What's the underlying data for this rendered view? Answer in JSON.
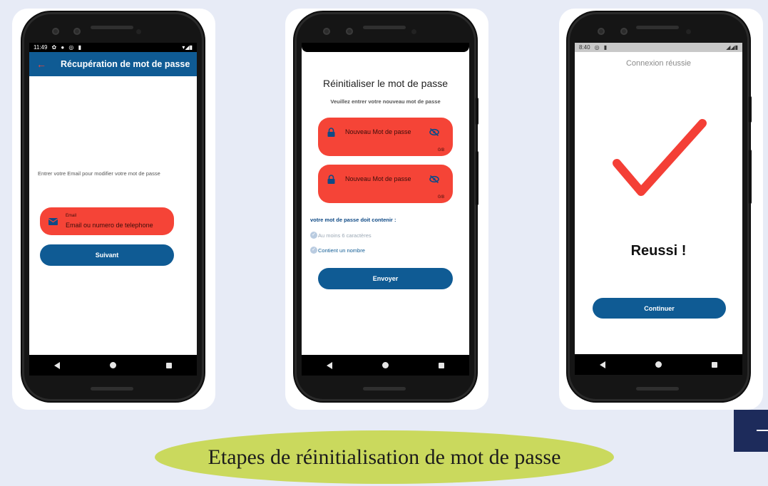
{
  "caption": "Etapes de réinitialisation de mot de passe",
  "colors": {
    "brand_blue": "#0f5b94",
    "field_red": "#f54437",
    "check_red": "#f43f36",
    "caption_bg": "#cad95d"
  },
  "screen1": {
    "status_time": "11:49",
    "header_title": "Récupération de mot de passe",
    "back_icon": "arrow-left-icon",
    "instruction": "Entrer votre Email pour modifier votre mot de passe",
    "email_label": "Email",
    "email_placeholder": "Email ou numero de telephone",
    "next_button": "Suivant"
  },
  "screen2": {
    "title": "Réinitialiser le mot de passe",
    "subtitle": "Veuillez entrer votre nouveau mot de passe",
    "field1_placeholder": "Nouveau Mot de passe",
    "field1_counter": "0/8",
    "field2_placeholder": "Nouveau Mot de passe",
    "field2_counter": "0/8",
    "requirements_title": "votre mot de passe doit contenir :",
    "requirement1": "Au moins 6 caractères",
    "requirement2": "Contient un nombre",
    "send_button": "Envoyer"
  },
  "screen3": {
    "status_time": "8:40",
    "header": "Connexion réussie",
    "success_text": "Reussi !",
    "continue_button": "Continuer"
  }
}
